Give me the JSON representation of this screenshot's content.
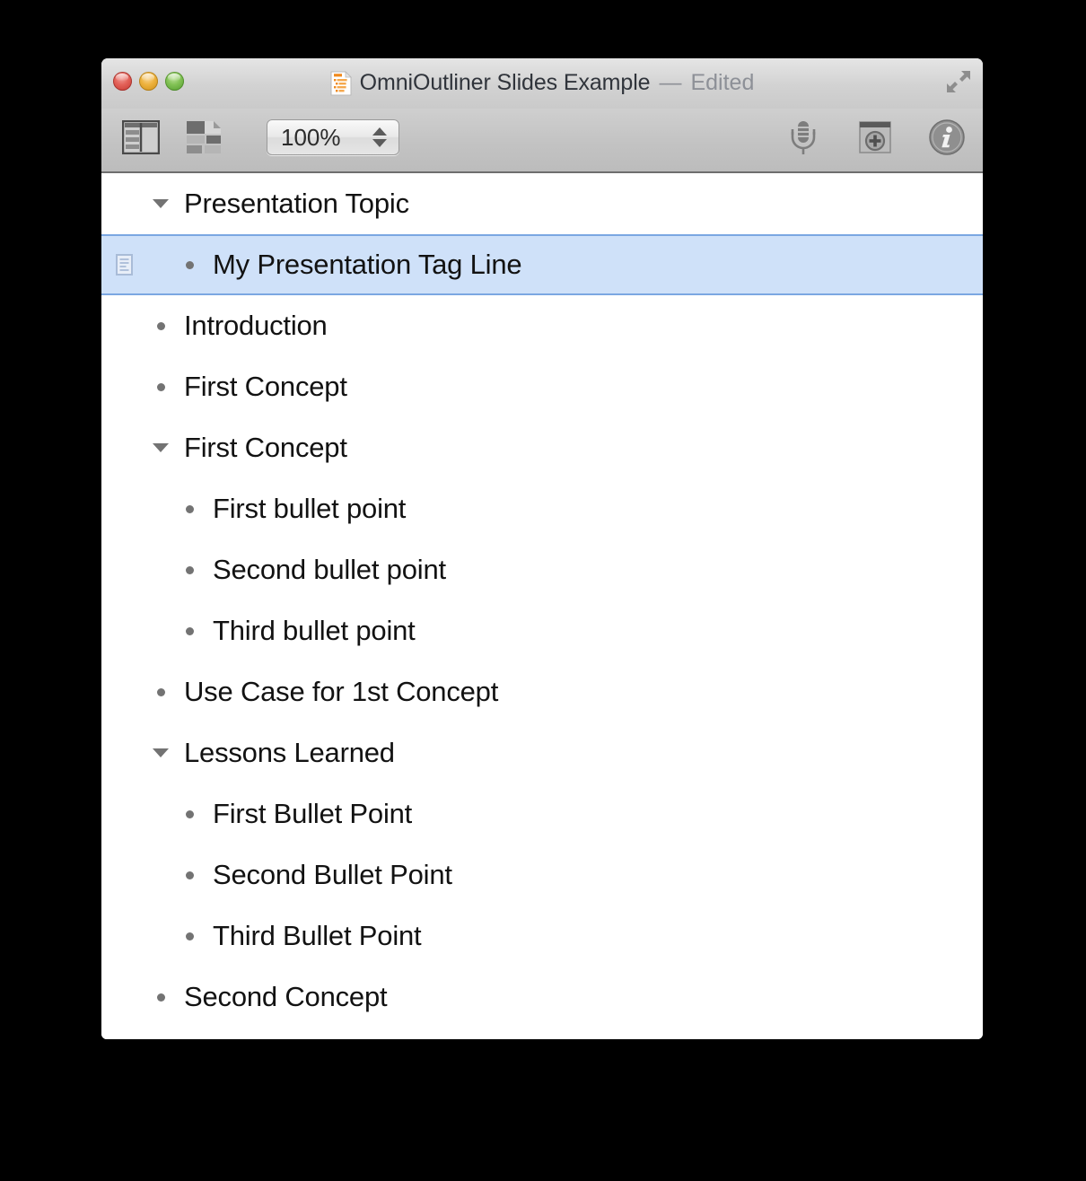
{
  "window": {
    "title": "OmniOutliner Slides Example",
    "title_separator": "—",
    "edited_status": "Edited",
    "doc_icon": "omnioutliner-document-icon",
    "traffic_lights": {
      "close": "close-button",
      "minimize": "minimize-button",
      "zoom": "zoom-button"
    },
    "fullscreen": "fullscreen-icon"
  },
  "toolbar": {
    "sidebar_toggle": "sidebar-view-icon",
    "slides_view": "slides-view-icon",
    "zoom": {
      "value": "100%",
      "stepper_up": "stepper-up-arrow",
      "stepper_down": "stepper-down-arrow"
    },
    "record_audio": "microphone-icon",
    "add_media": "add-media-icon",
    "inspector": "info-icon"
  },
  "outline": {
    "rows": [
      {
        "label": "Presentation Topic",
        "level": 1,
        "marker": "disclosure",
        "selected": false,
        "note": false
      },
      {
        "label": "My Presentation Tag Line",
        "level": 2,
        "marker": "bullet",
        "selected": true,
        "note": true
      },
      {
        "label": "Introduction",
        "level": 1,
        "marker": "bullet",
        "selected": false,
        "note": false
      },
      {
        "label": "First Concept",
        "level": 1,
        "marker": "bullet",
        "selected": false,
        "note": false
      },
      {
        "label": "First Concept",
        "level": 1,
        "marker": "disclosure",
        "selected": false,
        "note": false
      },
      {
        "label": "First bullet point",
        "level": 2,
        "marker": "bullet",
        "selected": false,
        "note": false
      },
      {
        "label": "Second bullet point",
        "level": 2,
        "marker": "bullet",
        "selected": false,
        "note": false
      },
      {
        "label": "Third bullet point",
        "level": 2,
        "marker": "bullet",
        "selected": false,
        "note": false
      },
      {
        "label": "Use Case for 1st Concept",
        "level": 1,
        "marker": "bullet",
        "selected": false,
        "note": false
      },
      {
        "label": "Lessons Learned",
        "level": 1,
        "marker": "disclosure",
        "selected": false,
        "note": false
      },
      {
        "label": "First Bullet Point",
        "level": 2,
        "marker": "bullet",
        "selected": false,
        "note": false
      },
      {
        "label": "Second Bullet Point",
        "level": 2,
        "marker": "bullet",
        "selected": false,
        "note": false
      },
      {
        "label": "Third Bullet Point",
        "level": 2,
        "marker": "bullet",
        "selected": false,
        "note": false
      },
      {
        "label": "Second Concept",
        "level": 1,
        "marker": "bullet",
        "selected": false,
        "note": false
      }
    ]
  },
  "colors": {
    "selection_fill": "#cfe1f9",
    "selection_border": "#7ba7e2",
    "titlebar": "#d2d2d2",
    "toolbar": "#c2c2c2",
    "text": "#121212",
    "muted_text": "#8d9097",
    "marker": "#737373",
    "doc_icon_accent": "#f08a1e"
  }
}
